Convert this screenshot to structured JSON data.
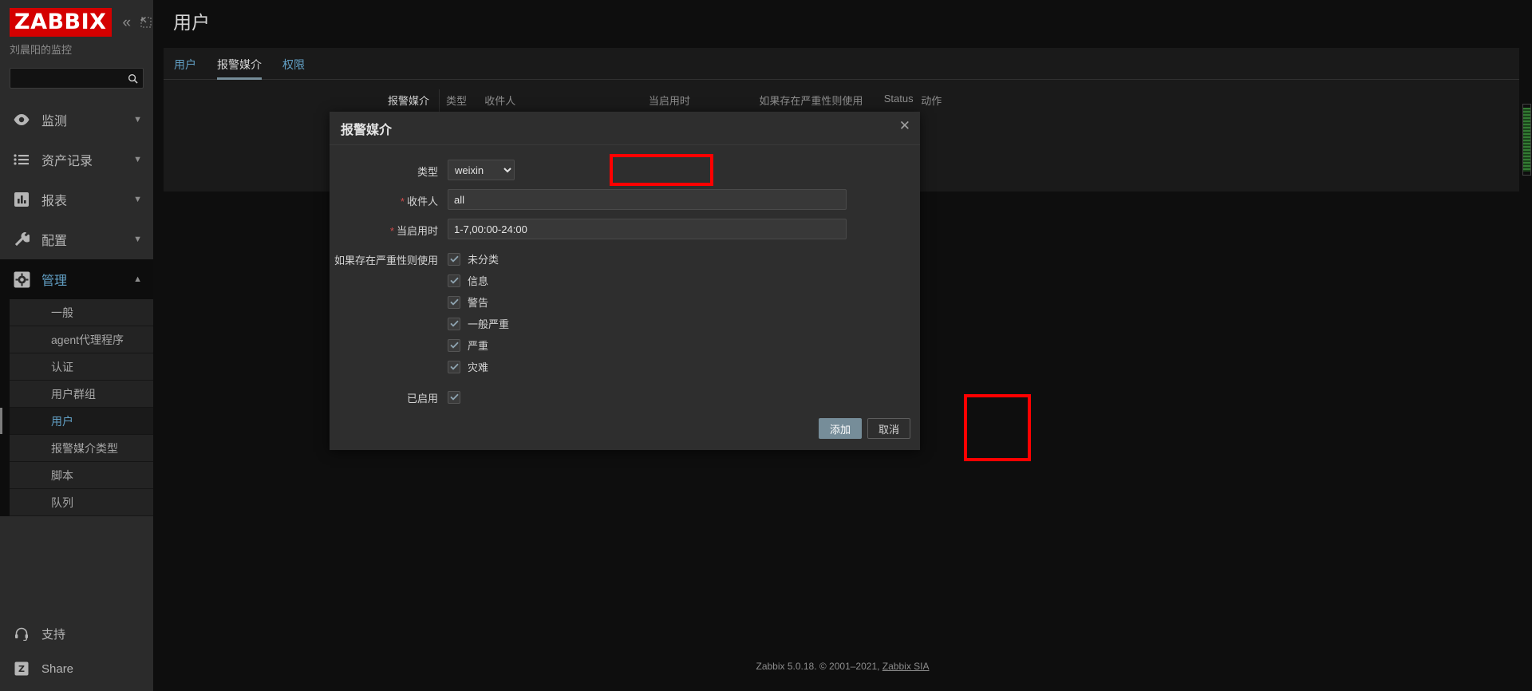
{
  "sidebar": {
    "logo_text": "ZABBIX",
    "server_name": "刘晨阳的监控",
    "collapse_icon": "chevron-double-left-icon",
    "compact_icon": "compact-view-icon",
    "search": {
      "value": "",
      "placeholder": ""
    },
    "nav": [
      {
        "label": "监测",
        "icon": "eye-icon",
        "expanded": false
      },
      {
        "label": "资产记录",
        "icon": "list-icon",
        "expanded": false
      },
      {
        "label": "报表",
        "icon": "chart-bar-icon",
        "expanded": false
      },
      {
        "label": "配置",
        "icon": "wrench-icon",
        "expanded": false
      },
      {
        "label": "管理",
        "icon": "gear-icon",
        "expanded": true
      }
    ],
    "submenu": [
      {
        "label": "一般",
        "selected": false
      },
      {
        "label": "agent代理程序",
        "selected": false
      },
      {
        "label": "认证",
        "selected": false
      },
      {
        "label": "用户群组",
        "selected": false
      },
      {
        "label": "用户",
        "selected": true
      },
      {
        "label": "报警媒介类型",
        "selected": false
      },
      {
        "label": "脚本",
        "selected": false
      },
      {
        "label": "队列",
        "selected": false
      }
    ],
    "bottom": [
      {
        "label": "支持",
        "icon": "headset-icon"
      },
      {
        "label": "Share",
        "icon": "zabbix-share-icon"
      }
    ]
  },
  "header": {
    "title": "用户"
  },
  "tabs": [
    {
      "label": "用户",
      "active": false
    },
    {
      "label": "报警媒介",
      "active": true
    },
    {
      "label": "权限",
      "active": false
    }
  ],
  "media_section": {
    "row_label": "报警媒介",
    "columns": [
      "类型",
      "收件人",
      "当启用时",
      "如果存在严重性则使用",
      "Status",
      "动作"
    ]
  },
  "modal": {
    "title": "报警媒介",
    "close_icon": "close-icon",
    "fields": {
      "type_label": "类型",
      "type_value": "weixin",
      "type_options": [
        "weixin"
      ],
      "recipient_label": "收件人",
      "recipient_required": "*",
      "recipient_value": "all",
      "when_label": "当启用时",
      "when_required": "*",
      "when_value": "1-7,00:00-24:00",
      "severity_label": "如果存在严重性则使用",
      "enabled_label": "已启用",
      "enabled_checked": true
    },
    "severities": [
      {
        "label": "未分类",
        "checked": true
      },
      {
        "label": "信息",
        "checked": true
      },
      {
        "label": "警告",
        "checked": true
      },
      {
        "label": "一般严重",
        "checked": true
      },
      {
        "label": "严重",
        "checked": true
      },
      {
        "label": "灾难",
        "checked": true
      }
    ],
    "buttons": {
      "submit": "添加",
      "cancel": "取消"
    }
  },
  "footer": {
    "text": "Zabbix 5.0.18. © 2001–2021, ",
    "link": "Zabbix SIA"
  },
  "colors": {
    "brand_red": "#d40000",
    "accent_blue": "#62a0c5",
    "button_primary": "#768d99",
    "annotation_red": "#ff0000",
    "required_red": "#d14c4c"
  }
}
